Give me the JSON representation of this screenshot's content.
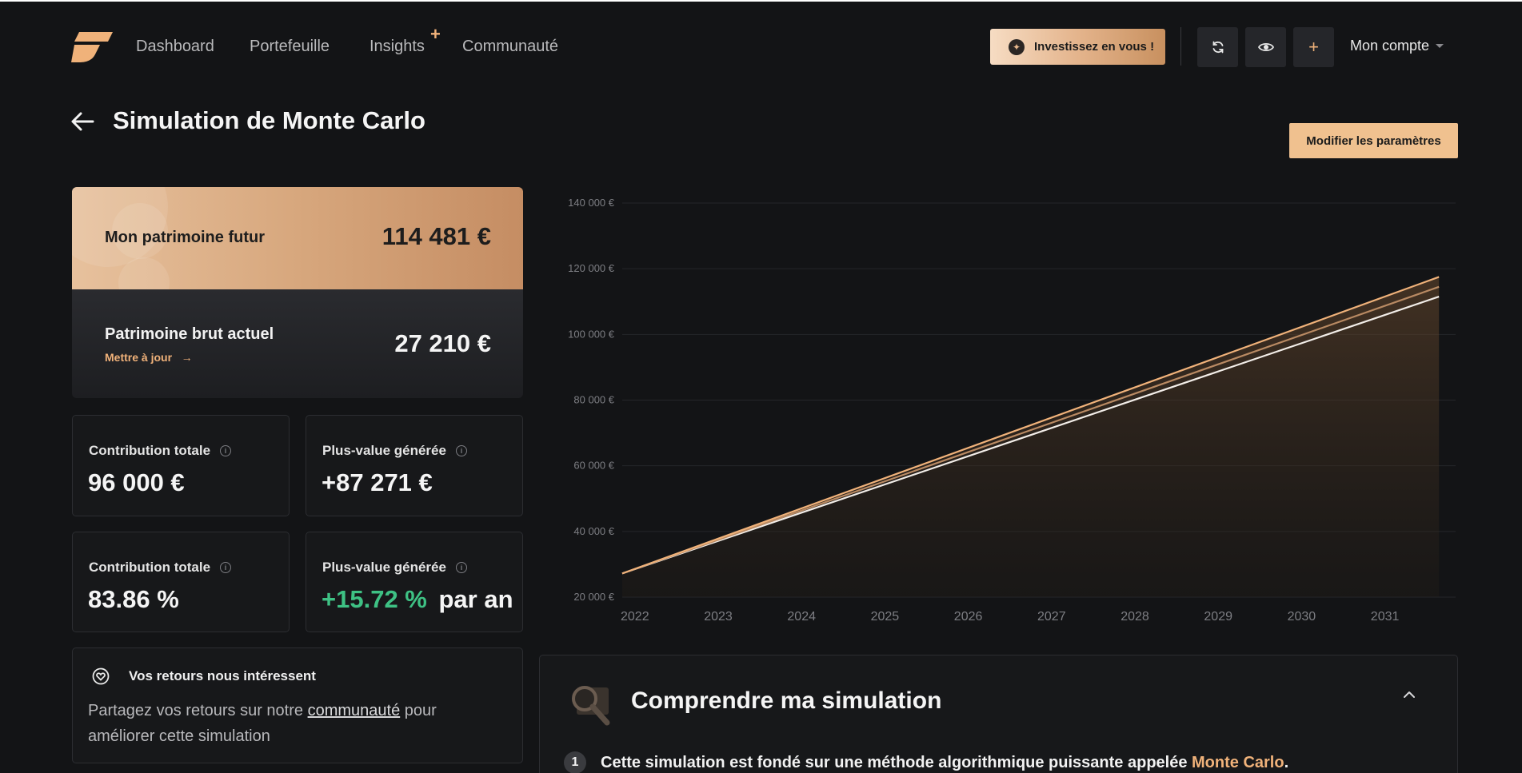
{
  "nav": {
    "links": [
      "Dashboard",
      "Portefeuille",
      "Insights",
      "Communauté"
    ],
    "insights_badge": "+",
    "invest_button": "Investissez en vous !",
    "account_label": "Mon compte",
    "icons": [
      "refresh-icon",
      "eye-icon",
      "plus-icon"
    ]
  },
  "page": {
    "title": "Simulation de Monte Carlo",
    "modify_button": "Modifier les paramètres"
  },
  "summary": {
    "future_label": "Mon patrimoine futur",
    "future_value": "114 481 €",
    "current_label": "Patrimoine brut actuel",
    "current_link": "Mettre à jour",
    "current_value": "27 210 €"
  },
  "stats": [
    {
      "label": "Contribution totale",
      "value": "96 000 €"
    },
    {
      "label": "Plus-value générée",
      "value": "+87 271 €"
    },
    {
      "label": "Contribution totale",
      "value": "83.86 %"
    },
    {
      "label": "Plus-value générée",
      "value_green": "+15.72 %",
      "value_suffix": "par an"
    }
  ],
  "feedback": {
    "title": "Vos retours nous intéressent",
    "text_before": "Partagez vos retours sur notre ",
    "link": "communauté",
    "text_after": " pour améliorer cette simulation"
  },
  "simulation": {
    "title": "Comprendre ma simulation",
    "step_number": "1",
    "step_text": "Cette simulation est fondé sur une méthode algorithmique puissante appelée ",
    "step_accent": "Monte Carlo",
    "step_end": "."
  },
  "colors": {
    "accent": "#f0b27a",
    "green": "#3ec184",
    "background": "#131416"
  },
  "chart_data": {
    "type": "line",
    "x_tick_labels": [
      "2022",
      "2023",
      "2024",
      "2025",
      "2026",
      "2027",
      "2028",
      "2029",
      "2030",
      "2031"
    ],
    "y_tick_labels": [
      "140 000 €",
      "120 000 €",
      "100 000 €",
      "80 000 €",
      "60 000 €",
      "40 000 €",
      "20 000 €"
    ],
    "y_ticks": [
      140000,
      120000,
      100000,
      80000,
      60000,
      40000,
      20000
    ],
    "ylim": [
      20000,
      140000
    ],
    "xlim": [
      2022,
      2032
    ],
    "grid": true,
    "series": [
      {
        "color": "#f0b27a",
        "points": [
          [
            2022,
            27210
          ],
          [
            2031.8,
            117500
          ]
        ]
      },
      {
        "color": "#b98a63",
        "points": [
          [
            2022,
            27210
          ],
          [
            2031.8,
            114481
          ]
        ]
      },
      {
        "color": "#f2ede8",
        "points": [
          [
            2022,
            27210
          ],
          [
            2031.8,
            111500
          ]
        ]
      }
    ]
  }
}
